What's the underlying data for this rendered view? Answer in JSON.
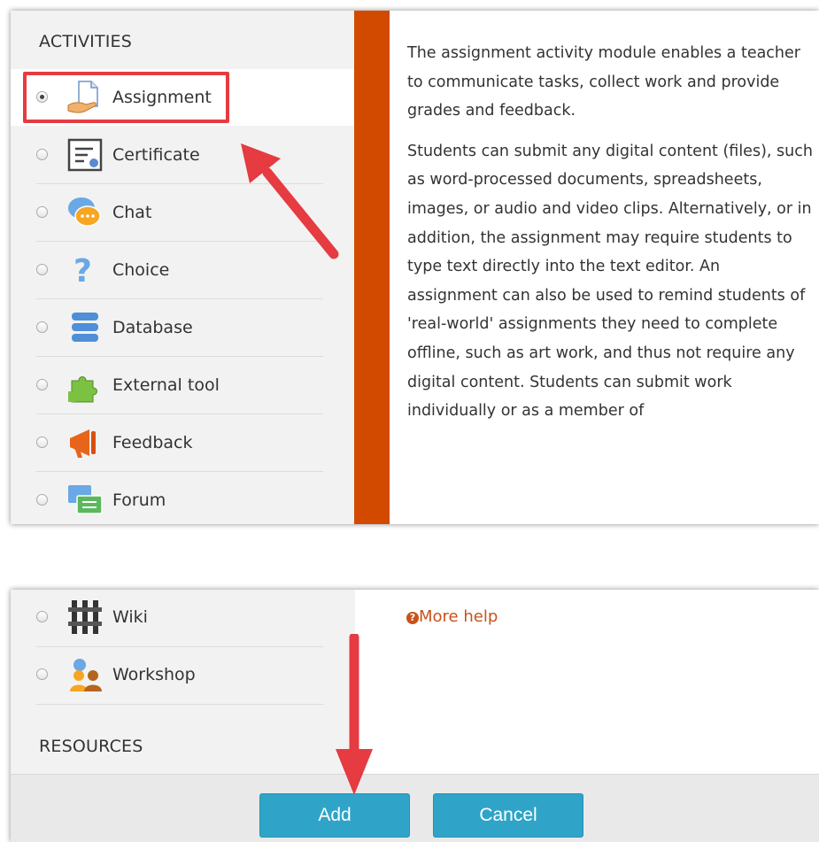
{
  "activities": {
    "heading": "ACTIVITIES",
    "items": [
      {
        "label": "Assignment",
        "icon": "assignment-icon",
        "selected": true
      },
      {
        "label": "Certificate",
        "icon": "certificate-icon"
      },
      {
        "label": "Chat",
        "icon": "chat-icon"
      },
      {
        "label": "Choice",
        "icon": "choice-icon"
      },
      {
        "label": "Database",
        "icon": "database-icon"
      },
      {
        "label": "External tool",
        "icon": "external-tool-icon"
      },
      {
        "label": "Feedback",
        "icon": "feedback-icon"
      },
      {
        "label": "Forum",
        "icon": "forum-icon"
      }
    ],
    "more_items": [
      {
        "label": "Wiki",
        "icon": "wiki-icon"
      },
      {
        "label": "Workshop",
        "icon": "workshop-icon"
      }
    ]
  },
  "resources": {
    "heading": "RESOURCES"
  },
  "description": {
    "paragraphs": [
      "The assignment activity module enables a teacher to communicate tasks, collect work and provide grades and feedback.",
      "Students can submit any digital content (files), such as word-processed documents, spreadsheets, images, or audio and video clips. Alternatively, or in addition, the assignment may require students to type text directly into the text editor. An assignment can also be used to remind students of 'real-world' assignments they need to complete offline, such as art work, and thus not require any digital content. Students can submit work individually or as a member of"
    ]
  },
  "more_help": {
    "label": "More help",
    "icon": "question-circle-icon"
  },
  "buttons": {
    "add": "Add",
    "cancel": "Cancel"
  },
  "colors": {
    "accent": "#2fa4c8",
    "strip": "#d14a00",
    "highlight": "#e53b41",
    "link": "#c8521c"
  }
}
